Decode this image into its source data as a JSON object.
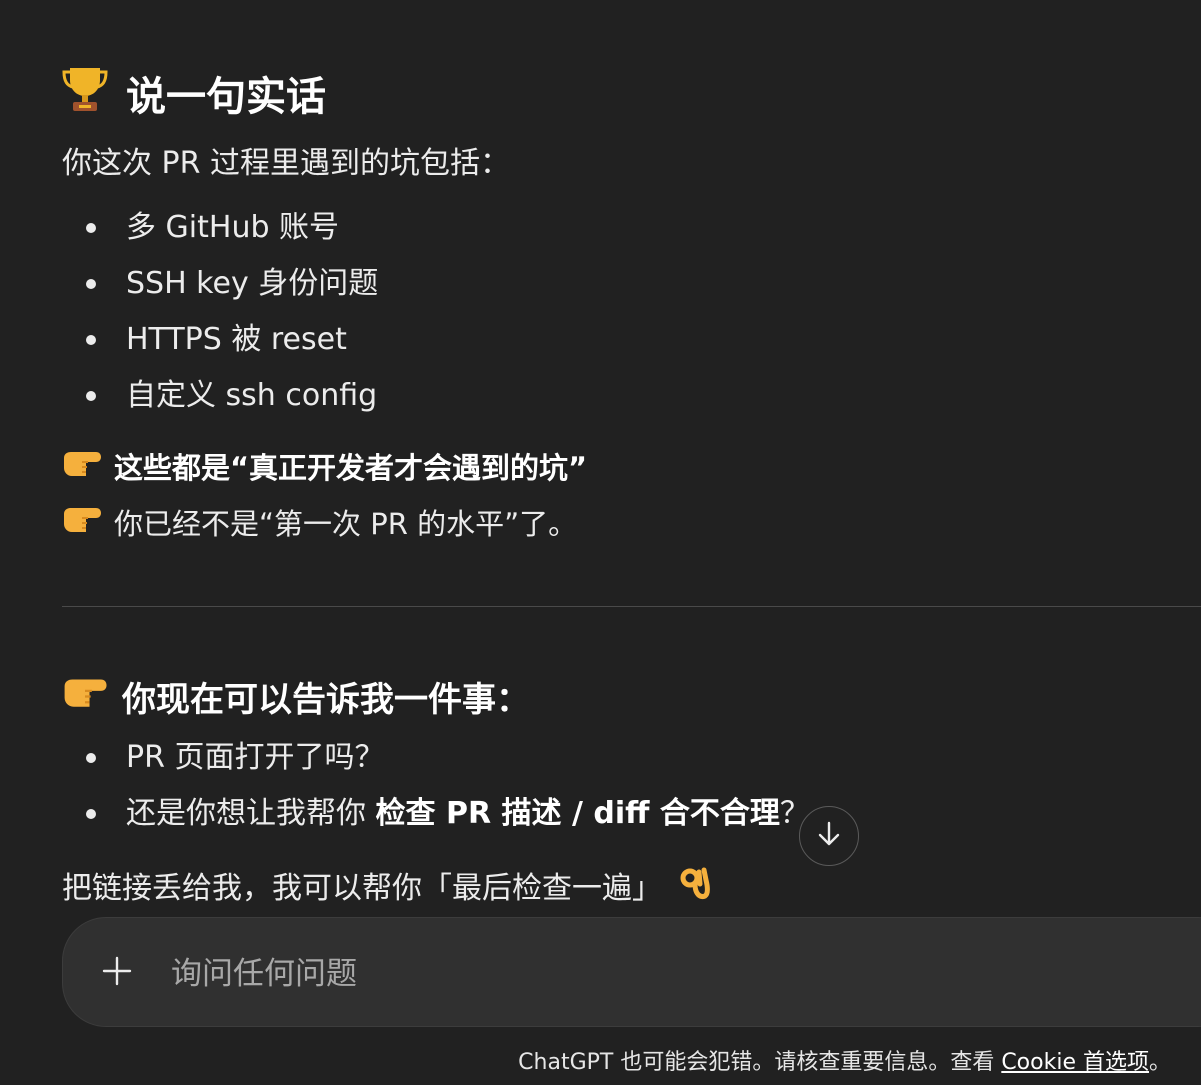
{
  "section1": {
    "heading": "说一句实话",
    "intro": "你这次 PR 过程里遇到的坑包括：",
    "items": [
      "多 GitHub 账号",
      "SSH key 身份问题",
      "HTTPS 被 reset",
      "自定义 ssh config"
    ],
    "line1_bold": "这些都是“真正开发者才会遇到的坑”",
    "line2": "你已经不是“第一次 PR 的水平”了。"
  },
  "section2": {
    "heading": "你现在可以告诉我一件事：",
    "item1": "PR 页面打开了吗？",
    "item2_prefix": "还是你想让我帮你 ",
    "item2_bold": "检查 PR 描述 / diff 合不合理",
    "item2_suffix": "？",
    "closing": "把链接丢给我，我可以帮你「最后检查一遍」"
  },
  "composer": {
    "placeholder": "询问任何问题"
  },
  "footer": {
    "text_before": "ChatGPT 也可能会犯错。请核查重要信息。查看 ",
    "link": "Cookie 首选项",
    "text_after": "。"
  },
  "icons": {
    "trophy": "trophy-icon",
    "pointing": "pointing-right-icon",
    "ok": "ok-hand-icon",
    "scroll": "arrow-down-icon",
    "plus": "plus-icon"
  }
}
